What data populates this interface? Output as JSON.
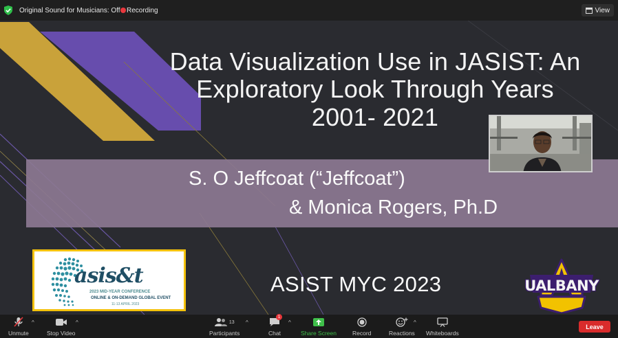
{
  "topbar": {
    "sound_label": "Original Sound for Musicians: Off",
    "recording_label": "Recording",
    "view_label": "View"
  },
  "slide": {
    "title_line1": "Data Visualization Use in JASIST: An",
    "title_line2": "Exploratory Look  Through Years",
    "title_line3": "2001- 2021",
    "author1": "S. O Jeffcoat (“Jeffcoat”)",
    "author2": "& Monica Rogers, Ph.D",
    "conference": "ASIST MYC 2023",
    "logo": {
      "brand": "asis&t",
      "line1": "2023 MID-YEAR CONFERENCE",
      "line2": "ONLINE & ON-DEMAND GLOBAL EVENT",
      "line3": "11-13 APRIL 2023"
    },
    "ualbany_logo": "UALBANY"
  },
  "toolbar": {
    "unmute": "Unmute",
    "stop_video": "Stop Video",
    "participants": "Participants",
    "participant_count": "13",
    "chat": "Chat",
    "chat_badge": "1",
    "share_screen": "Share Screen",
    "record": "Record",
    "reactions": "Reactions",
    "whiteboards": "Whiteboards",
    "leave": "Leave"
  },
  "colors": {
    "recording_dot": "#e8383d",
    "share_green": "#3fbf4a",
    "leave_red": "#d92c2c",
    "slide_bg": "#2a2b30",
    "gold": "#c9a23a",
    "purple": "#6a4fb4",
    "band": "#8c7893"
  }
}
